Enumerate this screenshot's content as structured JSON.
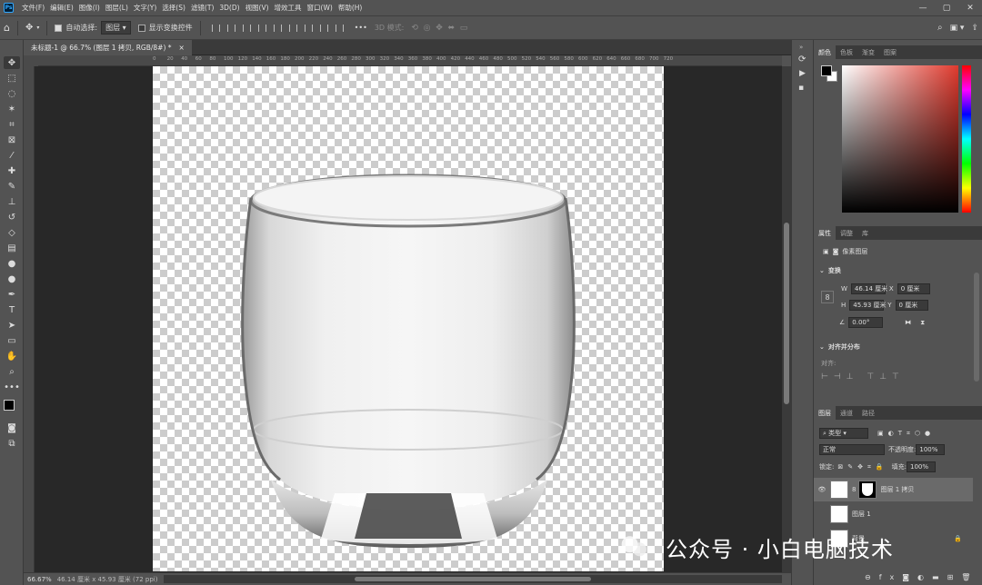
{
  "app": {
    "logo": "Ps"
  },
  "menubar": {
    "items": [
      "文件(F)",
      "编辑(E)",
      "图像(I)",
      "图层(L)",
      "文字(Y)",
      "选择(S)",
      "滤镜(T)",
      "3D(D)",
      "视图(V)",
      "增效工具",
      "窗口(W)",
      "帮助(H)"
    ]
  },
  "window_controls": {
    "minimize": "—",
    "maximize": "▢",
    "close": "✕"
  },
  "options": {
    "auto_select_label": "自动选择:",
    "auto_select_value": "图层",
    "show_transform_label": "显示变换控件",
    "mode_3d_label": "3D 模式:",
    "more": "•••"
  },
  "document_tab": {
    "title": "未标题-1 @ 66.7% (图层 1 拷贝, RGB/8#) *",
    "close": "×"
  },
  "ruler": {
    "h_ticks": [
      "0",
      "10",
      "20",
      "30",
      "40",
      "50",
      "60",
      "70",
      "80",
      "90",
      "100",
      "110",
      "120",
      "130",
      "140",
      "150",
      "160",
      "170",
      "180",
      "190",
      "200",
      "210",
      "220",
      "230",
      "240",
      "250",
      "260",
      "270",
      "280",
      "290",
      "300",
      "310",
      "320",
      "330",
      "340",
      "350",
      "360",
      "370",
      "380",
      "390",
      "400",
      "410",
      "420",
      "430",
      "440",
      "450",
      "460",
      "470",
      "480",
      "490",
      "500",
      "510",
      "520",
      "530",
      "540",
      "550",
      "560",
      "570",
      "580",
      "590",
      "600",
      "610",
      "620",
      "630",
      "640",
      "650",
      "660",
      "670",
      "680",
      "690",
      "700",
      "710",
      "720"
    ]
  },
  "status": {
    "zoom": "66.67%",
    "doc_info": "46.14 厘米 x 45.93 厘米 (72 ppi)",
    "arrow": ">"
  },
  "color_panel": {
    "tabs": [
      "颜色",
      "色板",
      "渐变",
      "图案"
    ],
    "accent": "#e03a2e"
  },
  "properties_panel": {
    "tabs": [
      "属性",
      "调整",
      "库"
    ],
    "layer_type": "像素图层",
    "transform_title": "变换",
    "w_label": "W",
    "w_value": "46.14 厘米",
    "h_label": "H",
    "h_value": "45.93 厘米",
    "x_label": "X",
    "x_value": "0 厘米",
    "y_label": "Y",
    "y_value": "0 厘米",
    "angle_value": "0.00°",
    "align_title": "对齐并分布",
    "align_label": "对齐:"
  },
  "layers_panel": {
    "tabs": [
      "图层",
      "通道",
      "路径"
    ],
    "filter_label": "类型",
    "blend_mode": "正常",
    "opacity_label": "不透明度:",
    "opacity_value": "100%",
    "lock_label": "锁定:",
    "fill_label": "填充:",
    "fill_value": "100%",
    "layers": [
      {
        "name": "图层 1 拷贝",
        "visible": true,
        "selected": true
      },
      {
        "name": "图层 1",
        "visible": false,
        "selected": false
      },
      {
        "name": "背景",
        "visible": false,
        "selected": false
      }
    ],
    "bottom_icons": [
      "link-icon",
      "fx-icon",
      "mask-icon",
      "adjustment-icon",
      "folder-icon",
      "new-layer-icon",
      "trash-icon"
    ]
  },
  "watermark": {
    "text": "公众号 · 小白电脑技术"
  }
}
